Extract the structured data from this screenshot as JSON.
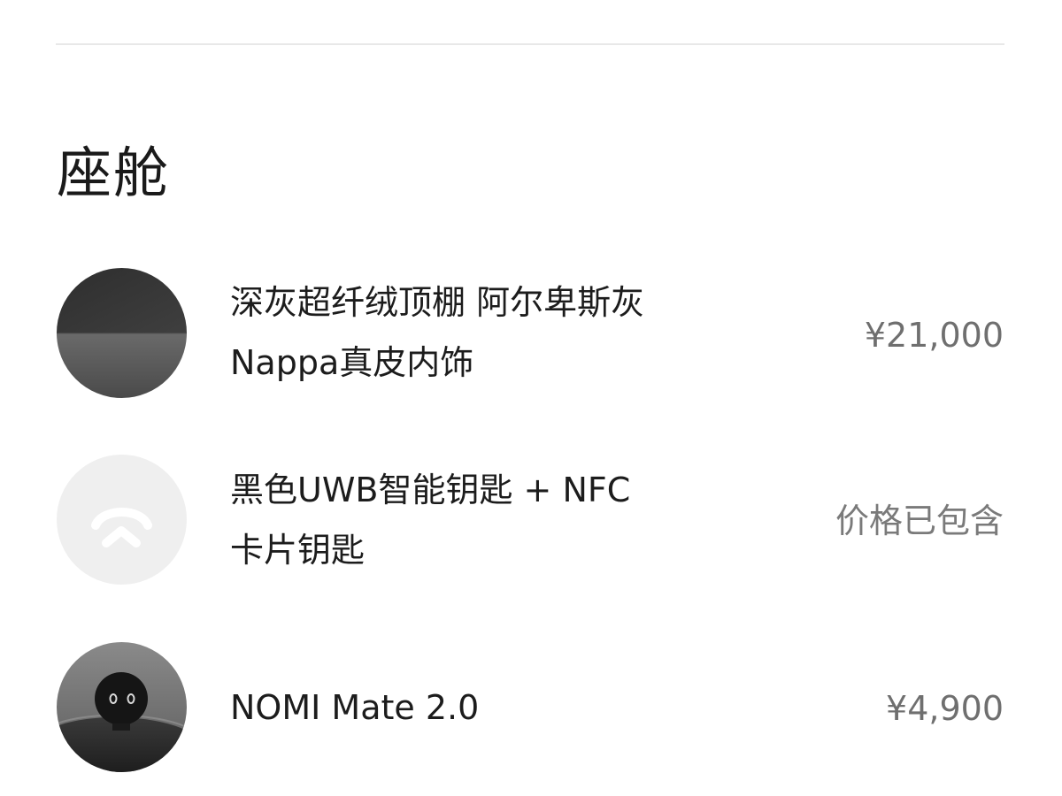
{
  "section": {
    "title": "座舱"
  },
  "options": [
    {
      "name_line1": "深灰超纤绒顶棚 阿尔卑斯灰",
      "name_line2": "Nappa真皮内饰",
      "price": "¥21,000",
      "thumb_icon": "interior-swatch-icon"
    },
    {
      "name_line1": "黑色UWB智能钥匙 + NFC",
      "name_line2": "卡片钥匙",
      "price": "价格已包含",
      "thumb_icon": "nio-logo-icon"
    },
    {
      "name_line1": "NOMI Mate 2.0",
      "price": "¥4,900",
      "thumb_icon": "nomi-robot-icon"
    }
  ],
  "colors": {
    "text_primary": "#1c1c1c",
    "text_secondary": "#6f6f6f",
    "divider": "#e8e8e8",
    "swatch_dark": "#3a3a3a",
    "swatch_grey": "#5a5a5a",
    "logo_bg": "#efefef"
  }
}
